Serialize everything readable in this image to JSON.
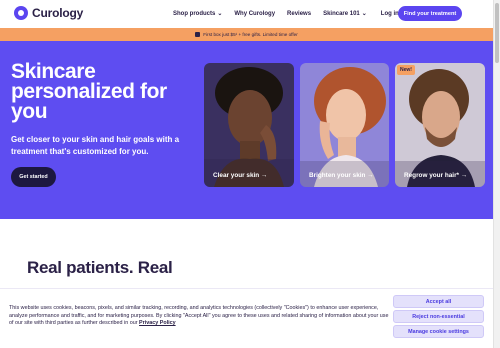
{
  "header": {
    "logo_text": "Curology",
    "nav": [
      {
        "label": "Shop products",
        "has_dropdown": true
      },
      {
        "label": "Why Curology",
        "has_dropdown": false
      },
      {
        "label": "Reviews",
        "has_dropdown": false
      },
      {
        "label": "Skincare 101",
        "has_dropdown": true
      },
      {
        "label": "Log in",
        "has_dropdown": false
      }
    ],
    "cta_label": "Find your treatment"
  },
  "promo": {
    "text": "First box just $5¹ + free gifts. Limited time offer"
  },
  "hero": {
    "title": "Skincare personalized for you",
    "subtitle": "Get closer to your skin and hair goals with a treatment that's customized for you.",
    "button_label": "Get started",
    "cards": [
      {
        "label": "Clear your skin →",
        "badge": ""
      },
      {
        "label": "Brighten your skin →",
        "badge": ""
      },
      {
        "label": "Regrow your hair* →",
        "badge": "New!"
      }
    ]
  },
  "section": {
    "heading": "Real patients. Real"
  },
  "cookie_banner": {
    "text": "This website uses cookies, beacons, pixels, and similar tracking, recording, and analytics technologies (collectively \"Cookies\") to enhance user experience, analyze performance and traffic, and for marketing purposes. By clicking \"Accept All\" you agree to these uses and related sharing of information about your use of our site with third parties as further described in our",
    "policy_link": "Privacy Policy",
    "buttons": {
      "accept": "Accept all",
      "reject": "Reject non-essential",
      "manage": "Manage cookie settings"
    }
  },
  "colors": {
    "brand": "#5e4df1",
    "promo": "#f5a062",
    "navy": "#2b2147"
  }
}
